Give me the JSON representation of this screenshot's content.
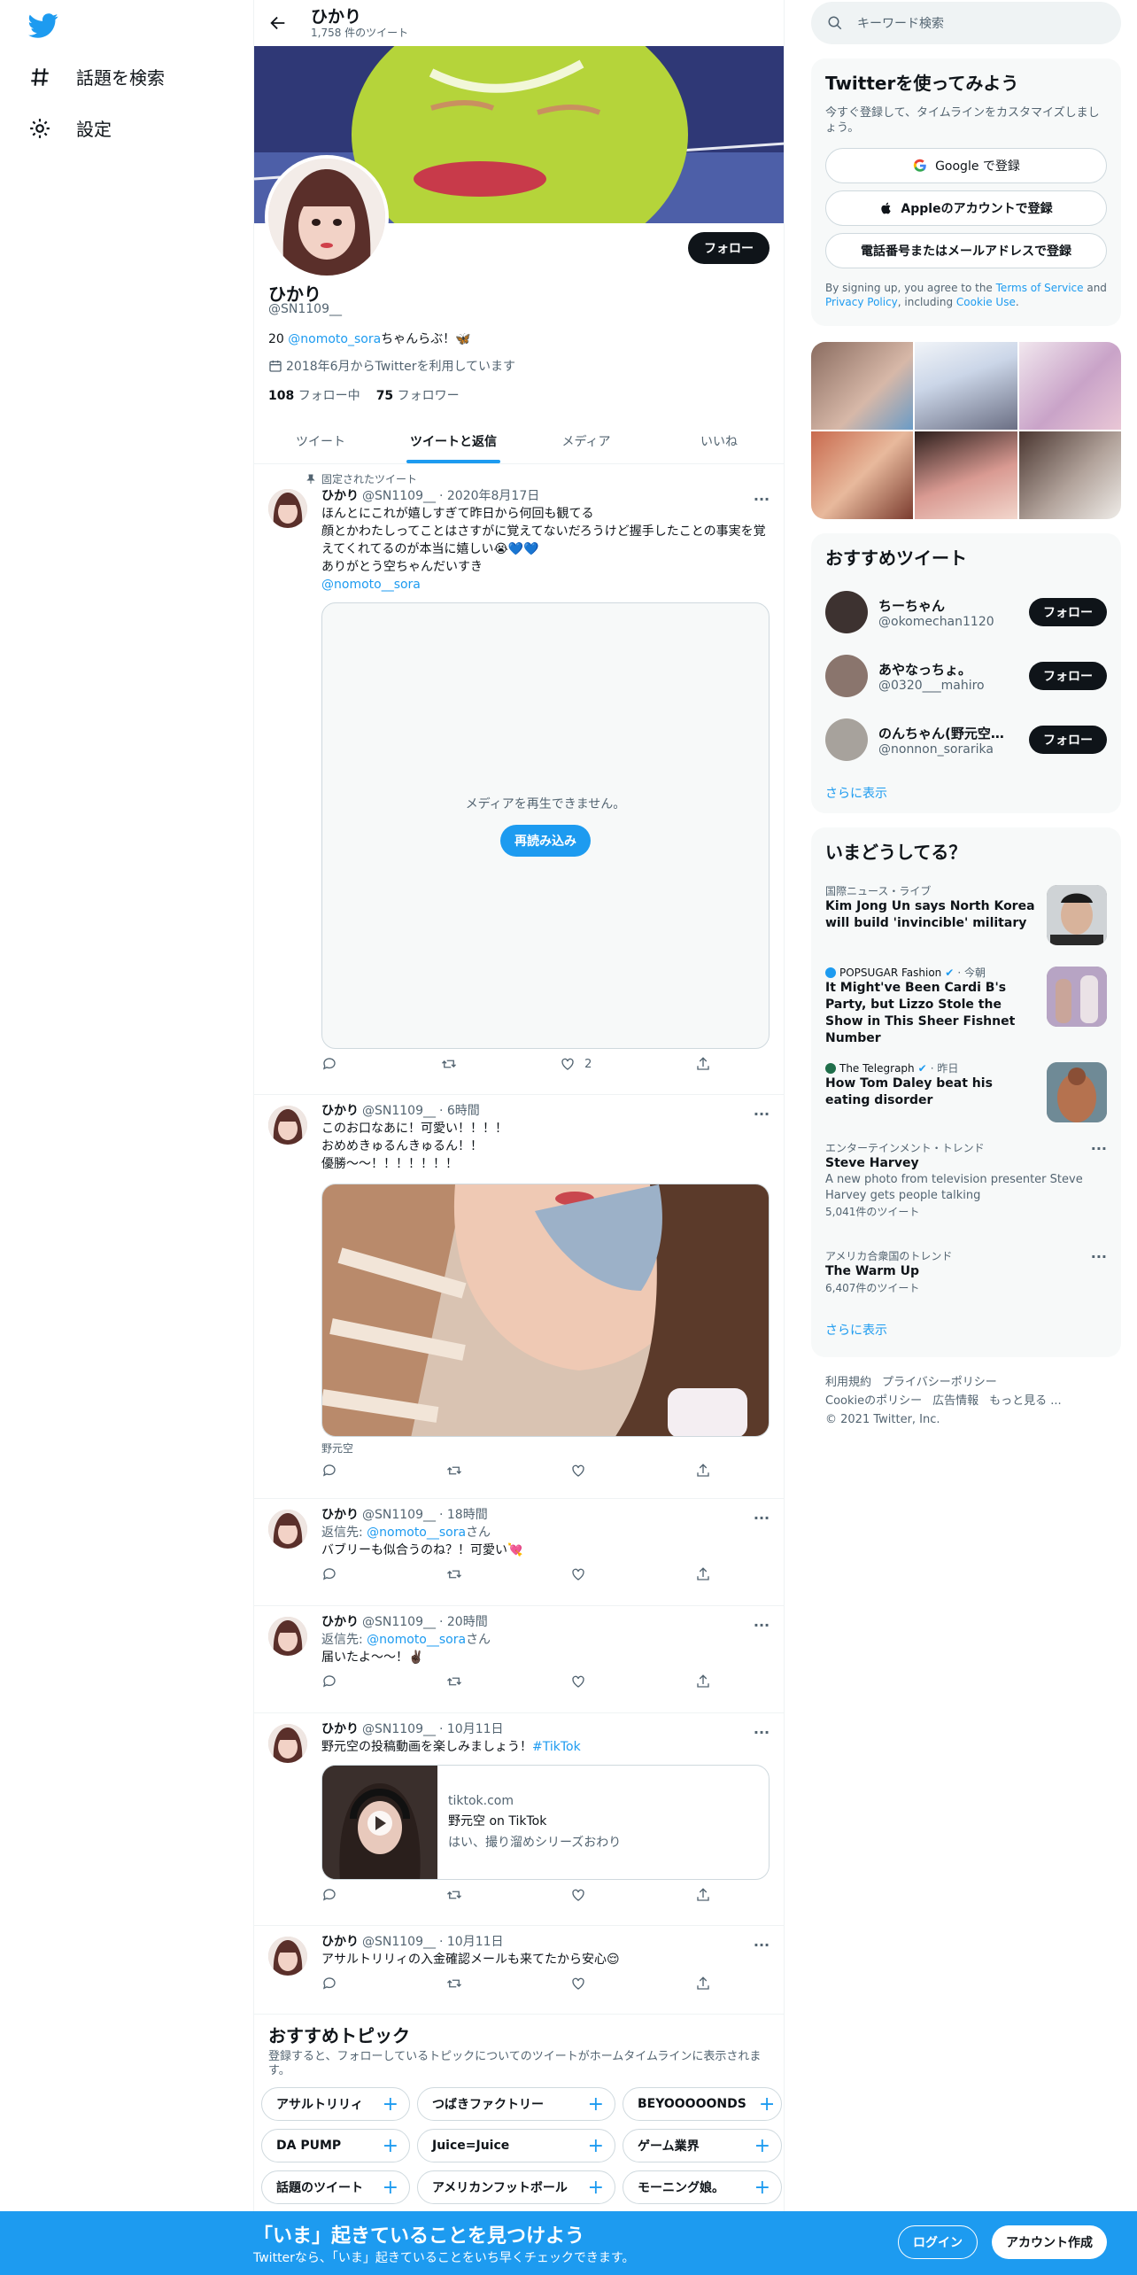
{
  "nav": {
    "explore": "話題を検索",
    "settings": "設定"
  },
  "header": {
    "name": "ひかり",
    "tweet_count": "1,758 件のツイート"
  },
  "profile": {
    "follow": "フォロー",
    "name": "ひかり",
    "handle": "@SN1109__",
    "bio_prefix": "20 ",
    "bio_mention": "@nomoto_sora",
    "bio_suffix": "ちゃんらぶ！🦋",
    "joined": "2018年6月からTwitterを利用しています",
    "following_count": "108",
    "following_label": "フォロー中",
    "followers_count": "75",
    "followers_label": "フォロワー"
  },
  "tabs": [
    "ツイート",
    "ツイートと返信",
    "メディア",
    "いいね"
  ],
  "tweets": [
    {
      "pinned": "固定されたツイート",
      "name": "ひかり",
      "handle": "@SN1109__",
      "time": "· 2020年8月17日",
      "text": "ほんとにこれが嬉しすぎて昨日から何回も観てる\n顔とかわたしってことはさすがに覚えてないだろうけど握手したことの事実を覚えてくれてるのが本当に嬉しい😭💙💙\nありがとう空ちゃんだいすき",
      "mention": "@nomoto__sora",
      "media_error": "メディアを再生できません。",
      "reload": "再読み込み",
      "likes": "2"
    },
    {
      "name": "ひかり",
      "handle": "@SN1109__",
      "time": "· 6時間",
      "text": "このお口なあに！可愛い！！！！\nおめめきゅるんきゅるん！！\n優勝〜〜！！！！！！！",
      "caption": "野元空"
    },
    {
      "name": "ひかり",
      "handle": "@SN1109__",
      "time": "· 18時間",
      "reply_prefix": "返信先: ",
      "reply_to": "@nomoto__sora",
      "reply_suffix": "さん",
      "text": "バブリーも似合うのね？！可愛い💘"
    },
    {
      "name": "ひかり",
      "handle": "@SN1109__",
      "time": "· 20時間",
      "reply_prefix": "返信先: ",
      "reply_to": "@nomoto__sora",
      "reply_suffix": "さん",
      "text": "届いたよ〜〜！✌🏿"
    },
    {
      "name": "ひかり",
      "handle": "@SN1109__",
      "time": "· 10月11日",
      "text": "野元空の投稿動画を楽しみましょう！",
      "hashtag": "#TikTok",
      "card_domain": "tiktok.com",
      "card_title": "野元空 on TikTok",
      "card_desc": "はい、撮り溜めシリーズおわり"
    },
    {
      "name": "ひかり",
      "handle": "@SN1109__",
      "time": "· 10月11日",
      "text": "アサルトリリィの入金確認メールも来てたから安心😌"
    }
  ],
  "topics": {
    "title": "おすすめトピック",
    "subtitle": "登録すると、フォローしているトピックについてのツイートがホームタイムラインに表示されます。",
    "items": [
      "アサルトリリィ",
      "つばきファクトリー",
      "BEYOOOOONDS",
      "DA PUMP",
      "Juice=Juice",
      "ゲーム業界",
      "話題のツイート",
      "アメリカンフットボール",
      "モーニング娘。"
    ]
  },
  "search": {
    "placeholder": "キーワード検索"
  },
  "signup": {
    "title": "Twitterを使ってみよう",
    "desc": "今すぐ登録して、タイムラインをカスタマイズしましょう。",
    "google": "Google で登録",
    "apple": "Appleのアカウントで登録",
    "phone": "電話番号またはメールアドレスで登録",
    "terms_a": "By signing up, you agree to the ",
    "terms_link": "Terms of Service",
    "terms_b": " and ",
    "privacy": "Privacy Policy",
    "terms_c": ", including ",
    "cookie": "Cookie Use",
    "terms_d": "."
  },
  "recommend": {
    "title": "おすすめツイート",
    "users": [
      {
        "name": "ちーちゃん",
        "handle": "@okomechan1120",
        "button": "フォロー"
      },
      {
        "name": "あやなっちょ。",
        "handle": "@0320___mahiro",
        "button": "フォロー"
      },
      {
        "name": "のんちゃん(野元空生誕祭…",
        "handle": "@nonnon_sorarika",
        "button": "フォロー"
      }
    ],
    "more": "さらに表示"
  },
  "trends": {
    "title": "いまどうしてる？",
    "items": [
      {
        "meta": "国際ニュース・ライブ",
        "title": "Kim Jong Un says North Korea will build 'invincible' military"
      },
      {
        "meta": "POPSUGAR Fashion",
        "meta_time": "· 今朝",
        "title": "It Might've Been Cardi B's Party, but Lizzo Stole the Show in This Sheer Fishnet Number"
      },
      {
        "meta": "The Telegraph",
        "meta_time": "· 昨日",
        "title": "How Tom Daley beat his eating disorder"
      },
      {
        "meta": "エンターテインメント・トレンド",
        "title": "Steve Harvey",
        "desc": "A new photo from television presenter Steve Harvey gets people talking",
        "count": "5,041件のツイート"
      },
      {
        "meta": "アメリカ合衆国のトレンド",
        "title": "The Warm Up",
        "count": "6,407件のツイート"
      }
    ],
    "more": "さらに表示"
  },
  "footer": {
    "terms": "利用規約",
    "privacy": "プライバシーポリシー",
    "cookie": "Cookieのポリシー",
    "ads": "広告情報",
    "more": "もっと見る ...",
    "copyright": "© 2021 Twitter, Inc."
  },
  "bottom": {
    "title": "「いま」起きていることを見つけよう",
    "subtitle": "Twitterなら、「いま」起きていることをいち早くチェックできます。",
    "login": "ログイン",
    "signup": "アカウント作成"
  },
  "colors": {
    "accent": "#1d9bf0",
    "text": "#0f1419",
    "muted": "#536471"
  }
}
